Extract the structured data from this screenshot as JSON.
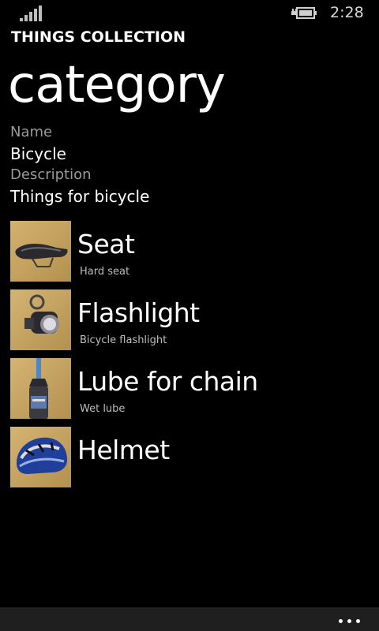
{
  "status_bar": {
    "time": "2:28",
    "signal_icon": "signal-strength-icon",
    "battery_icon": "battery-charging-icon"
  },
  "header": {
    "app_title": "THINGS COLLECTION",
    "page_title": "category"
  },
  "fields": {
    "name_label": "Name",
    "name_value": "Bicycle",
    "description_label": "Description",
    "description_value": "Things for bicycle"
  },
  "items": [
    {
      "name": "Seat",
      "description": "Hard seat",
      "thumbnail": "bicycle-seat-photo"
    },
    {
      "name": "Flashlight",
      "description": "Bicycle flashlight",
      "thumbnail": "flashlight-photo"
    },
    {
      "name": "Lube for chain",
      "description": "Wet lube",
      "thumbnail": "chain-lube-photo"
    },
    {
      "name": "Helmet",
      "description": "",
      "thumbnail": "helmet-photo"
    }
  ],
  "app_bar": {
    "more_icon": "ellipsis-icon"
  },
  "colors": {
    "background": "#000000",
    "label": "#9a9a9a",
    "text": "#ffffff",
    "app_bar": "#1f1f1f",
    "thumbnail_background": "#c9a55f"
  }
}
